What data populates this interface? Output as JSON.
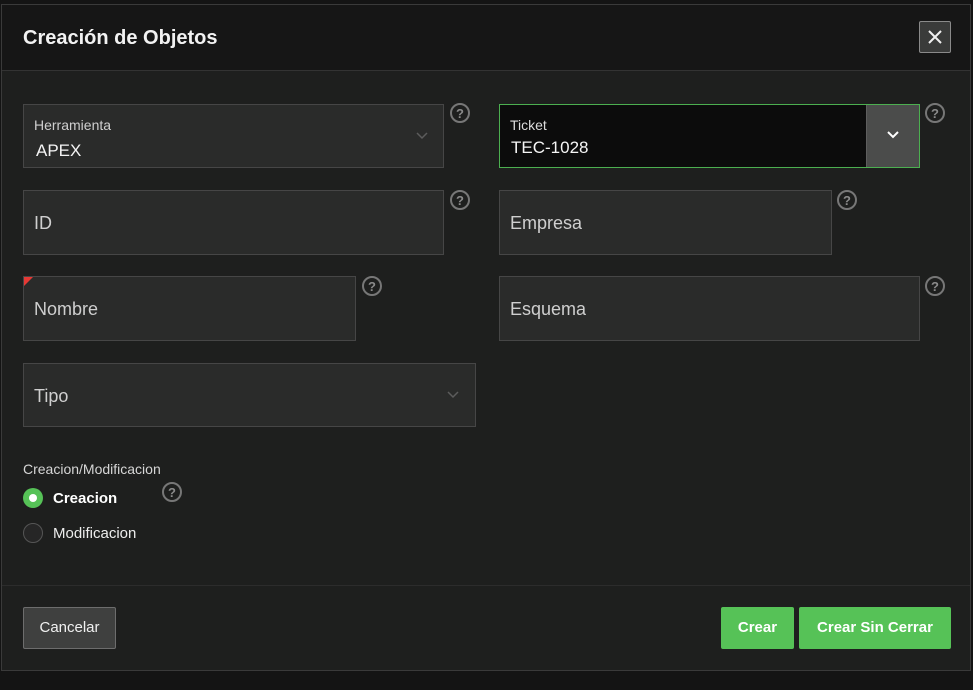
{
  "dialog": {
    "title": "Creación de Objetos",
    "close_icon": "close-icon"
  },
  "form": {
    "herramienta": {
      "label": "Herramienta",
      "value": "APEX"
    },
    "ticket": {
      "label": "Ticket",
      "value": "TEC-1028"
    },
    "id": {
      "placeholder": "ID"
    },
    "empresa": {
      "placeholder": "Empresa"
    },
    "nombre": {
      "placeholder": "Nombre",
      "required": true
    },
    "esquema": {
      "placeholder": "Esquema"
    },
    "tipo": {
      "placeholder": "Tipo"
    },
    "help_glyph": "?",
    "creacion_modificacion": {
      "label": "Creacion/Modificacion",
      "options": [
        {
          "label": "Creacion",
          "selected": true
        },
        {
          "label": "Modificacion",
          "selected": false
        }
      ]
    }
  },
  "footer": {
    "cancel_label": "Cancelar",
    "create_label": "Crear",
    "create_no_close_label": "Crear Sin Cerrar"
  },
  "colors": {
    "accent_green": "#56c257",
    "required_red": "#e53935",
    "background": "#1e1f1e"
  }
}
